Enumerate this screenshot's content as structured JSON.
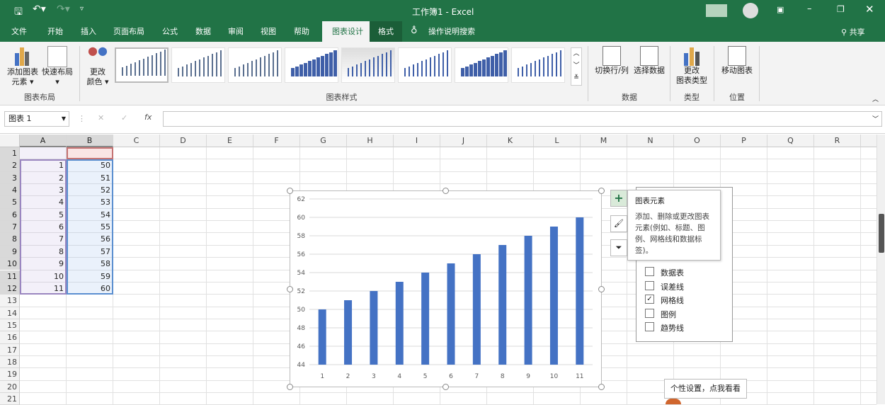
{
  "titlebar": {
    "title": "工作簿1  -  Excel",
    "qat": {
      "save": "save-icon",
      "undo": "undo-icon",
      "redo": "redo-icon",
      "customize": "customize-icon"
    }
  },
  "tabs": [
    "文件",
    "开始",
    "插入",
    "页面布局",
    "公式",
    "数据",
    "审阅",
    "视图",
    "帮助",
    "图表设计",
    "格式"
  ],
  "active_tab": "图表设计",
  "search": "操作说明搜索",
  "share": "共享",
  "ribbon": {
    "add_element": [
      "添加图表",
      "元素 ▾"
    ],
    "quick_layout": [
      "快速布局",
      "▾"
    ],
    "group_layout": "图表布局",
    "change_color": [
      "更改",
      "颜色 ▾"
    ],
    "group_styles": "图表样式",
    "switch_row_col": "切换行/列",
    "select_data": "选择数据",
    "group_data": "数据",
    "change_type": [
      "更改",
      "图表类型"
    ],
    "group_type": "类型",
    "move_chart": "移动图表",
    "group_location": "位置"
  },
  "formula_bar": {
    "name_box": "图表 1",
    "fx": "fx",
    "value": ""
  },
  "columns": [
    "A",
    "B",
    "C",
    "D",
    "E",
    "F",
    "G",
    "H",
    "I",
    "J",
    "K",
    "L",
    "M",
    "N",
    "O",
    "P",
    "Q",
    "R"
  ],
  "rows": 21,
  "cells": {
    "A": [
      "",
      "1",
      "2",
      "3",
      "4",
      "5",
      "6",
      "7",
      "8",
      "9",
      "10",
      "11"
    ],
    "B": [
      "",
      "50",
      "51",
      "52",
      "53",
      "54",
      "55",
      "56",
      "57",
      "58",
      "59",
      "60"
    ]
  },
  "chart_data": {
    "type": "bar",
    "categories": [
      "1",
      "2",
      "3",
      "4",
      "5",
      "6",
      "7",
      "8",
      "9",
      "10",
      "11"
    ],
    "values": [
      50,
      51,
      52,
      53,
      54,
      55,
      56,
      57,
      58,
      59,
      60
    ],
    "ylim": [
      44,
      62
    ],
    "yticks": [
      44,
      46,
      48,
      50,
      52,
      54,
      56,
      58,
      60,
      62
    ],
    "grid": true,
    "color": "#4472c4"
  },
  "chart_elements": {
    "tooltip_title": "图表元素",
    "tooltip_body": "添加、删除或更改图表元素(例如、标题、图例、网格线和数据标签)。",
    "items": [
      {
        "label": "数据表",
        "checked": false
      },
      {
        "label": "误差线",
        "checked": false
      },
      {
        "label": "网格线",
        "checked": true
      },
      {
        "label": "图例",
        "checked": false
      },
      {
        "label": "趋势线",
        "checked": false
      }
    ]
  },
  "hint": "个性设置，点我看看",
  "colors": {
    "accent": "#217346",
    "bar": "#4472c4"
  }
}
